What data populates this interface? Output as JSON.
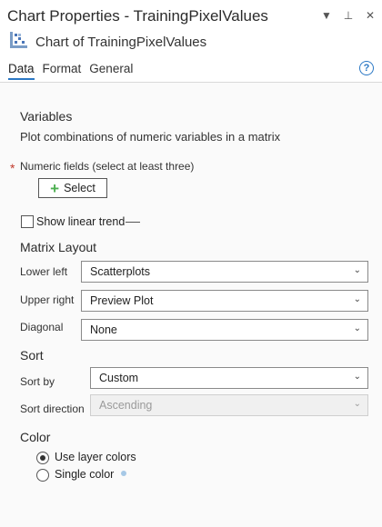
{
  "window": {
    "title": "Chart Properties - TrainingPixelValues",
    "subtitle": "Chart of TrainingPixelValues",
    "icons": [
      "chevron-down-icon",
      "pin-icon",
      "close-icon"
    ]
  },
  "tabs": [
    {
      "label": "Data",
      "active": true
    },
    {
      "label": "Format",
      "active": false
    },
    {
      "label": "General",
      "active": false
    }
  ],
  "variables": {
    "heading": "Variables",
    "description": "Plot combinations of numeric variables in a matrix",
    "required_mark": "*",
    "numeric_fields_label": "Numeric fields (select at least three)",
    "select_button": "Select",
    "show_linear_trend": "Show linear trend",
    "show_linear_trend_checked": false
  },
  "matrix_layout": {
    "heading": "Matrix Layout",
    "lower_left_label": "Lower left",
    "lower_left_value": "Scatterplots",
    "upper_right_label": "Upper right",
    "upper_right_value": "Preview Plot",
    "diagonal_label": "Diagonal",
    "diagonal_value": "None"
  },
  "sort": {
    "heading": "Sort",
    "sort_by_label": "Sort by",
    "sort_by_value": "Custom",
    "sort_direction_label": "Sort direction",
    "sort_direction_value": "Ascending"
  },
  "color": {
    "heading": "Color",
    "use_layer_colors": "Use layer colors",
    "single_color": "Single color",
    "selected": "use_layer_colors",
    "single_color_swatch": "#a6c8e6"
  },
  "colors": {
    "accent": "#2b78c5",
    "required": "#c0392b",
    "plus": "#4caf50"
  }
}
